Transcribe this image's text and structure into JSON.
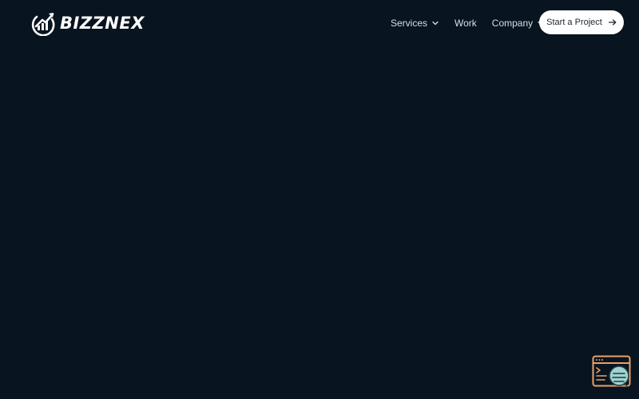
{
  "brand": {
    "name": "BIZZNEX",
    "logo_icon": "growth-arrow-circle-icon"
  },
  "nav": {
    "items": [
      {
        "label": "Services",
        "has_dropdown": true
      },
      {
        "label": "Work",
        "has_dropdown": false
      },
      {
        "label": "Company",
        "has_dropdown": true
      }
    ]
  },
  "cta": {
    "label": "Start a Project",
    "icon": "arrow-right-icon"
  },
  "widget": {
    "icon": "terminal-chat-icon"
  },
  "colors": {
    "background": "#08141f",
    "text": "#ffffff",
    "nav_text": "#d9dfe6",
    "cta_background": "#ffffff",
    "widget_accent": "#e8a06a",
    "widget_teal": "#9fd3d0"
  }
}
